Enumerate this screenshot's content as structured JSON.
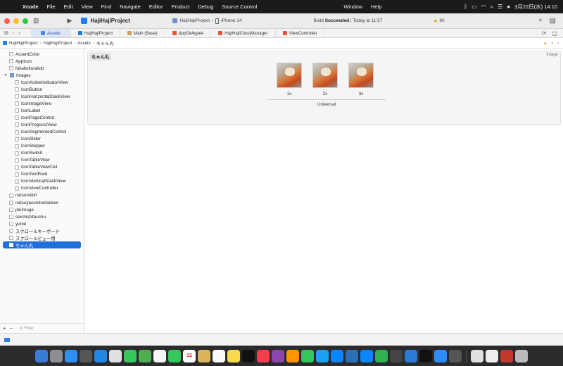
{
  "menubar": {
    "app_name": "Xcode",
    "menus": [
      "File",
      "Edit",
      "View",
      "Find",
      "Navigate",
      "Editor",
      "Product",
      "Debug",
      "Source Control",
      "Window",
      "Help"
    ],
    "datetime": "3月22日(水) 14:10"
  },
  "toolbar": {
    "project_name": "HajiHajiProject",
    "scheme": "HajiHajiProject",
    "device": "iPhone 14",
    "build_status_prefix": "Build",
    "build_status_bold": "Succeeded",
    "build_status_time": "| Today at 11:57",
    "warning_count": "90"
  },
  "tabs": [
    {
      "label": "Assets",
      "icon": "assets",
      "active": true
    },
    {
      "label": "HajiHajiProject",
      "icon": "proj"
    },
    {
      "label": "Main (Base)",
      "icon": "sb"
    },
    {
      "label": "AppDelegate",
      "icon": "swift"
    },
    {
      "label": "HajiHajiClassManager",
      "icon": "swift"
    },
    {
      "label": "ViewController",
      "icon": "swift"
    }
  ],
  "jumpbar": {
    "items": [
      "HajiHajiProject",
      "HajiHajiProject",
      "Assets",
      "ちゃん丸"
    ]
  },
  "navigator": {
    "items": [
      {
        "label": "AccentColor",
        "level": "top"
      },
      {
        "label": "AppIcon",
        "level": "top"
      },
      {
        "label": "fukakukuraiido",
        "level": "top"
      },
      {
        "label": "Images",
        "level": "folder"
      },
      {
        "label": "IconActiveIndicatorView",
        "level": "child"
      },
      {
        "label": "IconButton",
        "level": "child"
      },
      {
        "label": "IconHorizontalStackView",
        "level": "child"
      },
      {
        "label": "IconImageView",
        "level": "child"
      },
      {
        "label": "IconLabel",
        "level": "child"
      },
      {
        "label": "IconPageControl",
        "level": "child"
      },
      {
        "label": "IconProgressView",
        "level": "child"
      },
      {
        "label": "IconSegmentedControl",
        "level": "child"
      },
      {
        "label": "IconSlider",
        "level": "child"
      },
      {
        "label": "IconStepper",
        "level": "child"
      },
      {
        "label": "IconSwitch",
        "level": "child"
      },
      {
        "label": "IconTableView",
        "level": "child"
      },
      {
        "label": "IconTableViewCell",
        "level": "child"
      },
      {
        "label": "IconTextField",
        "level": "child"
      },
      {
        "label": "IconVierticalStackView",
        "level": "child"
      },
      {
        "label": "IconViewController",
        "level": "child"
      },
      {
        "label": "natsunokiri",
        "level": "top"
      },
      {
        "label": "natsuyasuminotanken",
        "level": "top"
      },
      {
        "label": "pinImage",
        "level": "top"
      },
      {
        "label": "seishishitauchu",
        "level": "top"
      },
      {
        "label": "yume",
        "level": "top"
      },
      {
        "label": "スクロールキーボード",
        "level": "top"
      },
      {
        "label": "スクロールビュー用",
        "level": "top"
      },
      {
        "label": "ちゃん丸",
        "level": "top",
        "selected": true
      }
    ],
    "filter_placeholder": "Filter"
  },
  "editor": {
    "asset_name": "ちゃん丸",
    "asset_type": "Image",
    "slots": [
      "1x",
      "2x",
      "3x"
    ],
    "group_label": "Universal"
  }
}
